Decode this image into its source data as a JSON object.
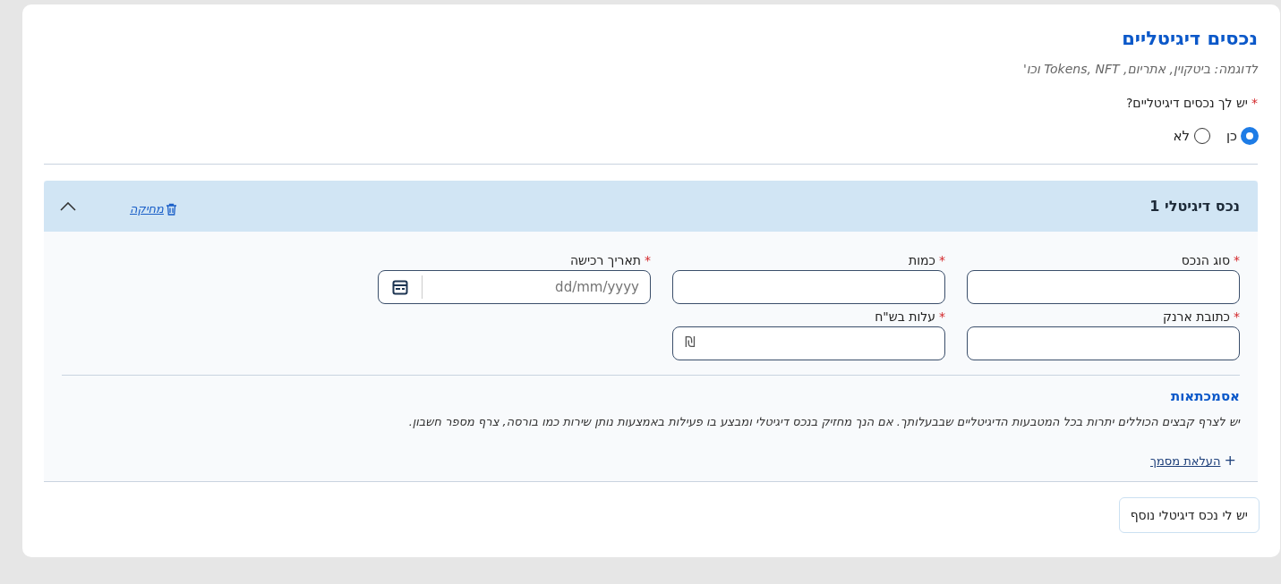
{
  "section": {
    "title": "נכסים דיגיטליים",
    "subtitle": "לדוגמה: ביטקוין, אתריום, Tokens, NFT וכו'"
  },
  "question": {
    "label": "יש לך נכסים דיגיטליים?",
    "required_mark": "*",
    "options": [
      {
        "label": "כן",
        "selected": true
      },
      {
        "label": "לא",
        "selected": false
      }
    ]
  },
  "assets": [
    {
      "title": "נכס דיגיטלי 1",
      "expanded": true,
      "delete_label": "מחיקה",
      "fields": [
        {
          "kind": "text",
          "label": "סוג הנכס",
          "required_mark": "*"
        },
        {
          "kind": "text",
          "label": "כמות",
          "required_mark": "*"
        },
        {
          "kind": "date",
          "label": "תאריך רכישה",
          "required_mark": "*",
          "placeholder": "dd/mm/yyyy"
        },
        {
          "kind": "text",
          "label": "כתובת ארנק",
          "required_mark": "*"
        },
        {
          "kind": "currency",
          "label": "עלות בש\"ח",
          "required_mark": "*",
          "symbol": "₪"
        }
      ],
      "attachments": {
        "title": "אסמכתאות",
        "description": "יש לצרף קבצים הכוללים יתרות בכל המטבעות הדיגיטליים שבבעלותך. אם הנך מחזיק בנכס דיגיטלי ומבצע בו פעילות באמצעות נותן שירות כמו בורסה, צרף מספר חשבון.",
        "upload_icon": "+",
        "upload_label": "העלאת מסמך"
      }
    }
  ],
  "add_button": "יש לי נכס דיגיטלי נוסף"
}
